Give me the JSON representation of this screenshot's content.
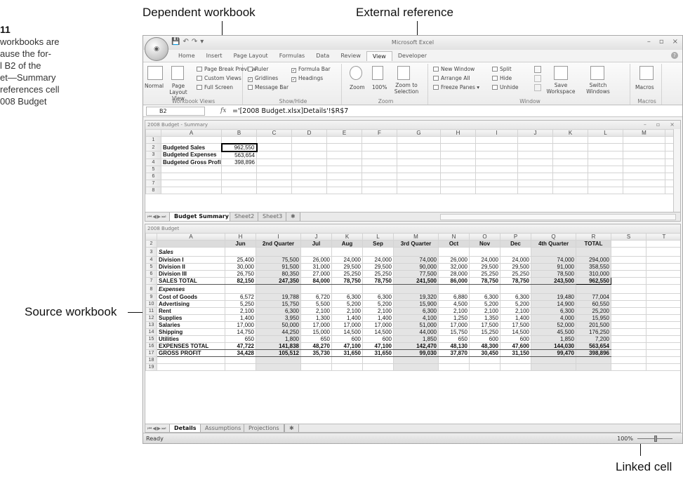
{
  "callouts": {
    "dependent": "Dependent workbook",
    "external": "External reference",
    "source": "Source workbook",
    "linked": "Linked cell"
  },
  "caption": {
    "number": "11",
    "lines": [
      "workbooks are",
      "ause the for-",
      "l B2 of the",
      "et—Summary",
      "references cell",
      "008 Budget"
    ]
  },
  "window": {
    "app_title": "Microsoft Excel",
    "office_button": "Office",
    "qat": [
      "💾",
      "↶",
      "↷",
      "▾"
    ],
    "controls": [
      "–",
      "▫",
      "×"
    ]
  },
  "ribbon_tabs": [
    "Home",
    "Insert",
    "Page Layout",
    "Formulas",
    "Data",
    "Review",
    "View",
    "Developer"
  ],
  "active_tab": "View",
  "ribbon": {
    "workbook_views": {
      "label": "Workbook Views",
      "normal": "Normal",
      "page_layout": "Page Layout View",
      "page_break": "Page Break Preview",
      "custom_views": "Custom Views",
      "full_screen": "Full Screen"
    },
    "show_hide": {
      "label": "Show/Hide",
      "ruler": "Ruler",
      "gridlines": "Gridlines",
      "message_bar": "Message Bar",
      "formula_bar": "Formula Bar",
      "headings": "Headings"
    },
    "zoom": {
      "label": "Zoom",
      "zoom": "Zoom",
      "hundred": "100%",
      "zoom_to_selection": "Zoom to Selection"
    },
    "window": {
      "label": "Window",
      "new_window": "New Window",
      "arrange_all": "Arrange All",
      "freeze_panes": "Freeze Panes",
      "split": "Split",
      "hide": "Hide",
      "unhide": "Unhide",
      "save_workspace": "Save Workspace",
      "switch_windows": "Switch Windows"
    },
    "macros": {
      "label": "Macros",
      "macros": "Macros"
    }
  },
  "formula_bar": {
    "cell_ref": "B2",
    "fx": "fx",
    "formula": "='[2008 Budget.xlsx]Details'!$R$7"
  },
  "summary_wb": {
    "title": "2008 Budget - Summary",
    "columns": [
      "A",
      "B",
      "C",
      "D",
      "E",
      "F",
      "G",
      "H",
      "I",
      "J",
      "K",
      "L",
      "M",
      "N"
    ],
    "rows": [
      {
        "n": "1",
        "a": "",
        "b": ""
      },
      {
        "n": "2",
        "a": "Budgeted Sales",
        "b": "962,550"
      },
      {
        "n": "3",
        "a": "Budgeted Expenses",
        "b": "563,654"
      },
      {
        "n": "4",
        "a": "Budgeted Gross Profit",
        "b": "398,896"
      },
      {
        "n": "5",
        "a": "",
        "b": ""
      },
      {
        "n": "6",
        "a": "",
        "b": ""
      },
      {
        "n": "7",
        "a": "",
        "b": ""
      },
      {
        "n": "8",
        "a": "",
        "b": ""
      }
    ],
    "sheets": [
      "Budget Summary",
      "Sheet2",
      "Sheet3"
    ]
  },
  "details_wb": {
    "title": "2008 Budget",
    "columns": [
      "A",
      "H",
      "I",
      "J",
      "K",
      "L",
      "M",
      "N",
      "O",
      "P",
      "Q",
      "R",
      "S",
      "T"
    ],
    "header_row": [
      "",
      "Jun",
      "2nd Quarter",
      "Jul",
      "Aug",
      "Sep",
      "3rd Quarter",
      "Oct",
      "Nov",
      "Dec",
      "4th Quarter",
      "TOTAL"
    ],
    "rows": [
      {
        "n": "3",
        "type": "sect",
        "cells": [
          "Sales"
        ]
      },
      {
        "n": "4",
        "type": "data",
        "cells": [
          "Division I",
          "25,400",
          "75,500",
          "26,000",
          "24,000",
          "24,000",
          "74,000",
          "26,000",
          "24,000",
          "24,000",
          "74,000",
          "294,000"
        ]
      },
      {
        "n": "5",
        "type": "data",
        "cells": [
          "Division II",
          "30,000",
          "91,500",
          "31,000",
          "29,500",
          "29,500",
          "90,000",
          "32,000",
          "29,500",
          "29,500",
          "91,000",
          "358,550"
        ]
      },
      {
        "n": "6",
        "type": "data",
        "cells": [
          "Division III",
          "26,750",
          "80,350",
          "27,000",
          "25,250",
          "25,250",
          "77,500",
          "28,000",
          "25,250",
          "25,250",
          "78,500",
          "310,000"
        ]
      },
      {
        "n": "7",
        "type": "total",
        "cells": [
          "SALES TOTAL",
          "82,150",
          "247,350",
          "84,000",
          "78,750",
          "78,750",
          "241,500",
          "86,000",
          "78,750",
          "78,750",
          "243,500",
          "962,550"
        ]
      },
      {
        "n": "8",
        "type": "sect",
        "cells": [
          "Expenses"
        ]
      },
      {
        "n": "9",
        "type": "data",
        "cells": [
          "Cost of Goods",
          "6,572",
          "19,788",
          "6,720",
          "6,300",
          "6,300",
          "19,320",
          "6,880",
          "6,300",
          "6,300",
          "19,480",
          "77,004"
        ]
      },
      {
        "n": "10",
        "type": "data",
        "cells": [
          "Advertising",
          "5,250",
          "15,750",
          "5,500",
          "5,200",
          "5,200",
          "15,900",
          "4,500",
          "5,200",
          "5,200",
          "14,900",
          "60,550"
        ]
      },
      {
        "n": "11",
        "type": "data",
        "cells": [
          "Rent",
          "2,100",
          "6,300",
          "2,100",
          "2,100",
          "2,100",
          "6,300",
          "2,100",
          "2,100",
          "2,100",
          "6,300",
          "25,200"
        ]
      },
      {
        "n": "12",
        "type": "data",
        "cells": [
          "Supplies",
          "1,400",
          "3,950",
          "1,300",
          "1,400",
          "1,400",
          "4,100",
          "1,250",
          "1,350",
          "1,400",
          "4,000",
          "15,950"
        ]
      },
      {
        "n": "13",
        "type": "data",
        "cells": [
          "Salaries",
          "17,000",
          "50,000",
          "17,000",
          "17,000",
          "17,000",
          "51,000",
          "17,000",
          "17,500",
          "17,500",
          "52,000",
          "201,500"
        ]
      },
      {
        "n": "14",
        "type": "data",
        "cells": [
          "Shipping",
          "14,750",
          "44,250",
          "15,000",
          "14,500",
          "14,500",
          "44,000",
          "15,750",
          "15,250",
          "14,500",
          "45,500",
          "176,250"
        ]
      },
      {
        "n": "15",
        "type": "data",
        "cells": [
          "Utilities",
          "650",
          "1,800",
          "650",
          "600",
          "600",
          "1,850",
          "650",
          "600",
          "600",
          "1,850",
          "7,200"
        ]
      },
      {
        "n": "16",
        "type": "total",
        "cells": [
          "EXPENSES TOTAL",
          "47,722",
          "141,838",
          "48,270",
          "47,100",
          "47,100",
          "142,470",
          "48,130",
          "48,300",
          "47,600",
          "144,030",
          "563,654"
        ]
      },
      {
        "n": "17",
        "type": "total",
        "cells": [
          "GROSS PROFIT",
          "34,428",
          "105,512",
          "35,730",
          "31,650",
          "31,650",
          "99,030",
          "37,870",
          "30,450",
          "31,150",
          "99,470",
          "398,896"
        ]
      },
      {
        "n": "18",
        "type": "blank",
        "cells": []
      },
      {
        "n": "19",
        "type": "blank",
        "cells": []
      }
    ],
    "sheets": [
      "Details",
      "Assumptions",
      "Projections"
    ]
  },
  "status": {
    "ready": "Ready",
    "zoom": "100%"
  }
}
